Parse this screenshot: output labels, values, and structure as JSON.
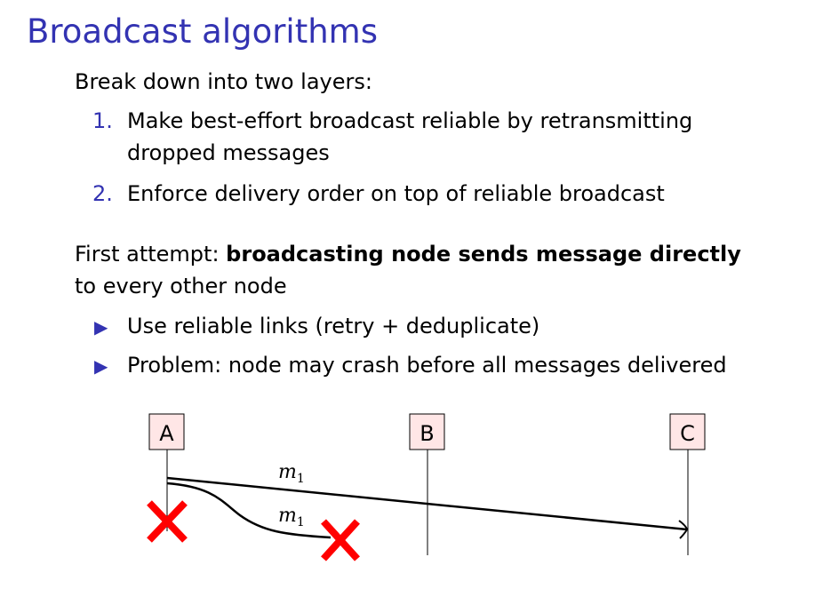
{
  "title": "Broadcast algorithms",
  "intro": "Break down into two layers:",
  "steps": [
    {
      "num": "1.",
      "line1": "Make best-effort broadcast reliable by retransmitting",
      "line2": "dropped messages"
    },
    {
      "num": "2.",
      "line1": "Enforce delivery order on top of reliable broadcast"
    }
  ],
  "attempt": {
    "prefix": "First attempt: ",
    "bold": "broadcasting node sends message directly",
    "line2": "to every other node"
  },
  "bullets": [
    "Use reliable links (retry + deduplicate)",
    "Problem: node may crash before all messages delivered"
  ],
  "diagram": {
    "nodes": [
      "A",
      "B",
      "C"
    ],
    "message_label": "m",
    "message_sub": "1",
    "crash_color": "#ff0000",
    "node_fill": "#ffe6e6",
    "accent": "#3333b2"
  }
}
